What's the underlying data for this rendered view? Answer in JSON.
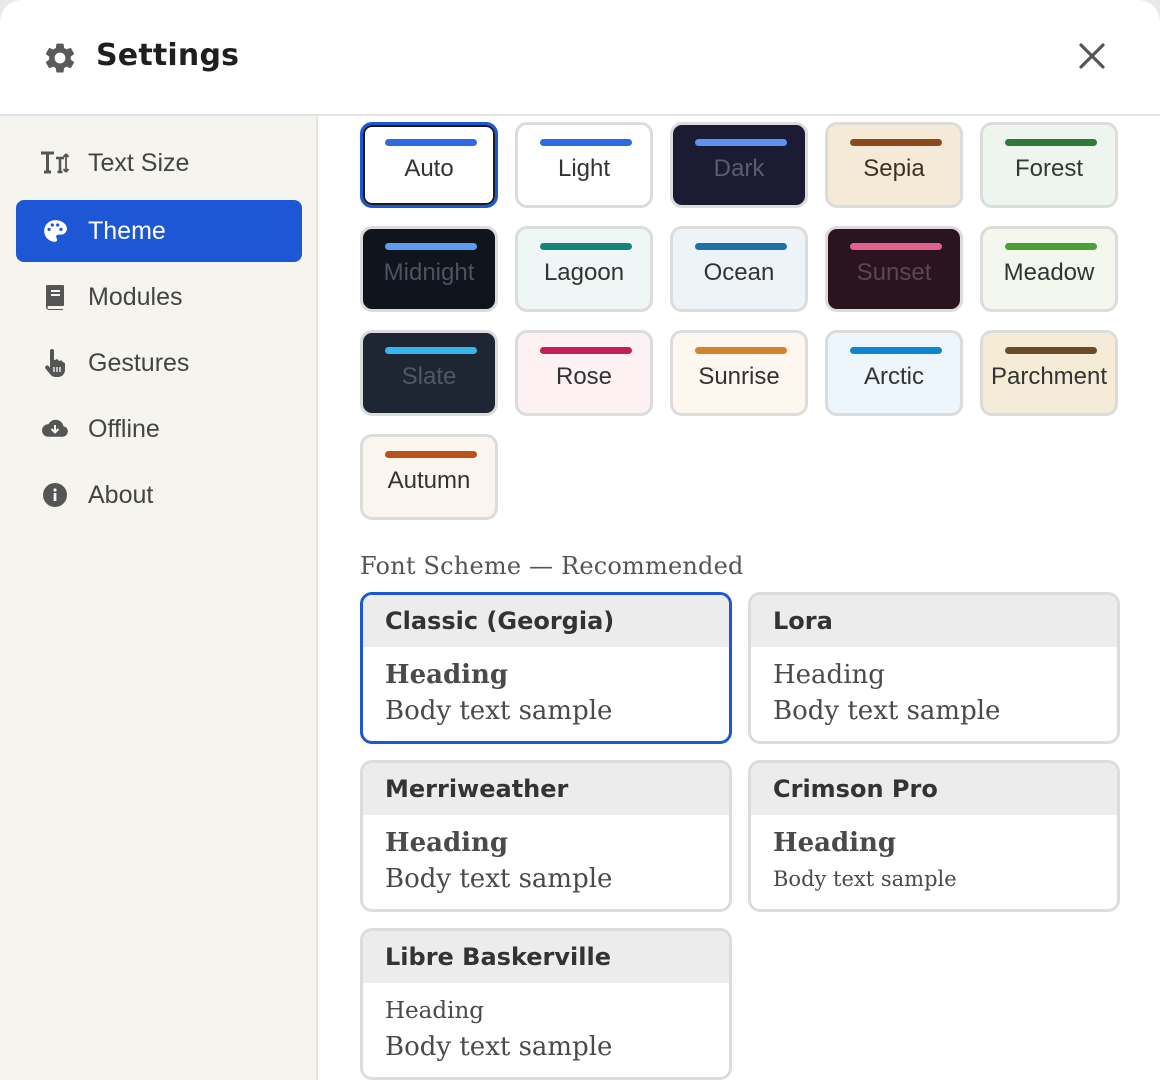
{
  "header": {
    "title": "Settings"
  },
  "sidebar": {
    "items": [
      {
        "label": "Text Size",
        "icon": "text-size-icon"
      },
      {
        "label": "Theme",
        "icon": "palette-icon",
        "active": true
      },
      {
        "label": "Modules",
        "icon": "book-icon"
      },
      {
        "label": "Gestures",
        "icon": "hand-pointer-icon"
      },
      {
        "label": "Offline",
        "icon": "cloud-download-icon"
      },
      {
        "label": "About",
        "icon": "info-icon"
      }
    ]
  },
  "themes": [
    {
      "label": "Auto",
      "bg": "#ffffff",
      "accent": "#2f6be0",
      "text": "#333333",
      "selected": true
    },
    {
      "label": "Light",
      "bg": "#ffffff",
      "accent": "#2f6be0",
      "text": "#333333"
    },
    {
      "label": "Dark",
      "bg": "#1b1c33",
      "accent": "#5a93f0",
      "text": "#5b5d6e"
    },
    {
      "label": "Sepia",
      "bg": "#f4ead7",
      "accent": "#8a4a1e",
      "text": "#3b332a"
    },
    {
      "label": "Forest",
      "bg": "#eef4ee",
      "accent": "#2e7a3b",
      "text": "#2f3a30"
    },
    {
      "label": "Midnight",
      "bg": "#0f141d",
      "accent": "#5b9df2",
      "text": "#4b5261"
    },
    {
      "label": "Lagoon",
      "bg": "#eef7f5",
      "accent": "#14857b",
      "text": "#333333"
    },
    {
      "label": "Ocean",
      "bg": "#eef3f7",
      "accent": "#2070a8",
      "text": "#333333"
    },
    {
      "label": "Sunset",
      "bg": "#2a1420",
      "accent": "#e0628a",
      "text": "#5e4552"
    },
    {
      "label": "Meadow",
      "bg": "#f3f7ee",
      "accent": "#4aa035",
      "text": "#333333"
    },
    {
      "label": "Slate",
      "bg": "#1e2533",
      "accent": "#36b6ee",
      "text": "#4f5868"
    },
    {
      "label": "Rose",
      "bg": "#fdf1f3",
      "accent": "#c41e5a",
      "text": "#333333"
    },
    {
      "label": "Sunrise",
      "bg": "#fdf7ef",
      "accent": "#d6822e",
      "text": "#333333"
    },
    {
      "label": "Arctic",
      "bg": "#eef6fd",
      "accent": "#0f86d0",
      "text": "#333333"
    },
    {
      "label": "Parchment",
      "bg": "#f5ecd7",
      "accent": "#6b4a26",
      "text": "#333333"
    },
    {
      "label": "Autumn",
      "bg": "#faf6ef",
      "accent": "#b8541a",
      "text": "#333333"
    }
  ],
  "font_section": {
    "label": "Font Scheme — Recommended"
  },
  "font_schemes": [
    {
      "name": "Classic (Georgia)",
      "heading": "Heading",
      "body": "Body text sample",
      "selected": true
    },
    {
      "name": "Lora",
      "heading": "Heading",
      "body": "Body text sample"
    },
    {
      "name": "Merriweather",
      "heading": "Heading",
      "body": "Body text sample"
    },
    {
      "name": "Crimson Pro",
      "heading": "Heading",
      "body": "Body text sample"
    },
    {
      "name": "Libre Baskerville",
      "heading": "Heading",
      "body": "Body text sample"
    }
  ]
}
